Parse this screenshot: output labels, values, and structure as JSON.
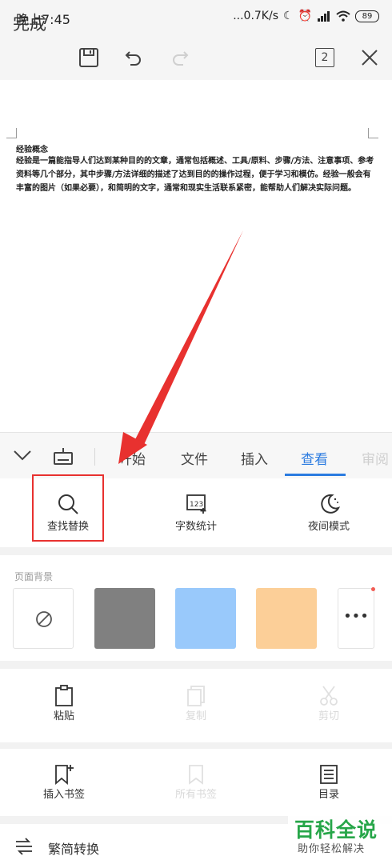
{
  "status_bar": {
    "time": "晚上7:45",
    "network_speed": "...0.7K/s",
    "battery_level": "89"
  },
  "toolbar": {
    "done_label": "完成",
    "page_count": "2",
    "icons": [
      "save-icon",
      "undo-icon",
      "redo-icon",
      "close-icon"
    ]
  },
  "document": {
    "heading": "经验概念",
    "body": "经验是一篇能指导人们达到某种目的的文章，通常包括概述、工具/原料、步骤/方法、注意事项、参考资料等几个部分，其中步骤/方法详细的描述了达到目的的操作过程，便于学习和模仿。经验一般会有丰富的图片（如果必要），和简明的文字，通常和现实生活联系紧密，能帮助人们解决实际问题。"
  },
  "tabs": [
    {
      "label": "开始",
      "visible_text": "开始",
      "active": false
    },
    {
      "label": "文件",
      "active": false
    },
    {
      "label": "插入",
      "active": false
    },
    {
      "label": "查看",
      "active": true
    },
    {
      "label": "审阅",
      "active": false
    }
  ],
  "view_tools": [
    {
      "label": "查找替换",
      "icon": "search-icon"
    },
    {
      "label": "字数统计",
      "icon": "word-count-icon"
    },
    {
      "label": "夜间模式",
      "icon": "moon-icon"
    }
  ],
  "page_background": {
    "title": "页面背景",
    "swatches": [
      "none",
      "#808080",
      "#99c9fb",
      "#fccf98",
      "more"
    ]
  },
  "edit_tools": [
    {
      "label": "粘贴",
      "enabled": true
    },
    {
      "label": "复制",
      "enabled": false
    },
    {
      "label": "剪切",
      "enabled": false
    }
  ],
  "bookmark_tools": [
    {
      "label": "插入书签",
      "enabled": true
    },
    {
      "label": "所有书签",
      "enabled": false
    },
    {
      "label": "目录",
      "enabled": true
    }
  ],
  "convert": {
    "label": "繁简转换"
  },
  "watermark": {
    "title": "百科全说",
    "subtitle": "助你轻松解决"
  },
  "colors": {
    "accent": "#2b7be0",
    "highlight": "#e8312f",
    "arrow": "#e8312f",
    "watermark_green": "#27a649"
  }
}
